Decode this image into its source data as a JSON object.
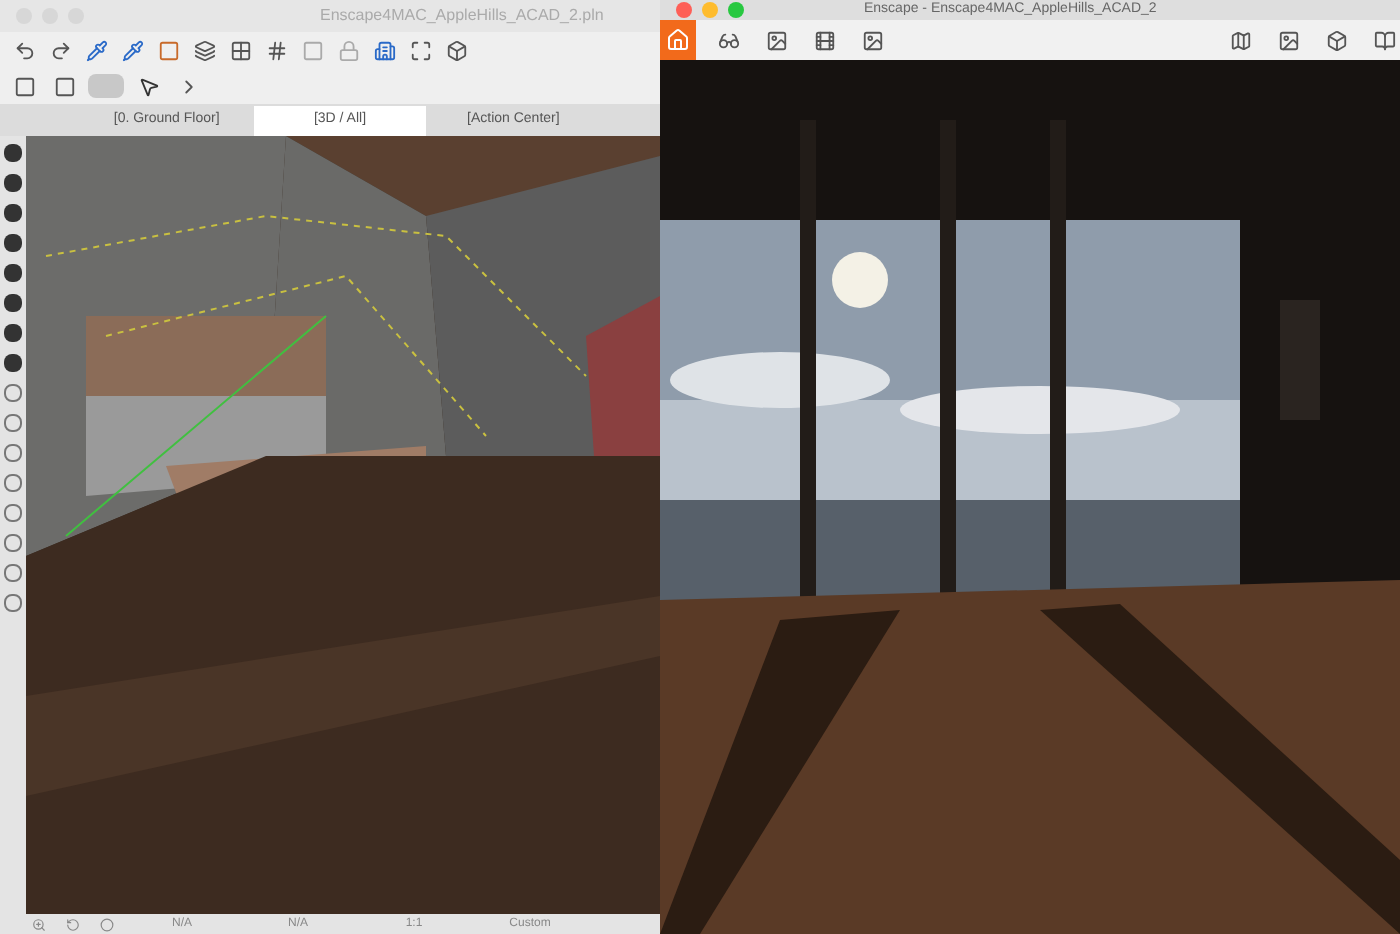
{
  "left_window": {
    "title": "Enscape4MAC_AppleHills_ACAD_2.pln",
    "tabs": [
      {
        "label": "[0. Ground Floor]",
        "selected": false
      },
      {
        "label": "[3D / All]",
        "selected": true
      },
      {
        "label": "[Action Center]",
        "selected": false
      }
    ],
    "status_bar": [
      "N/A",
      "N/A",
      "1:1",
      "Custom"
    ]
  },
  "right_window": {
    "title": "Enscape - Enscape4MAC_AppleHills_ACAD_2"
  }
}
